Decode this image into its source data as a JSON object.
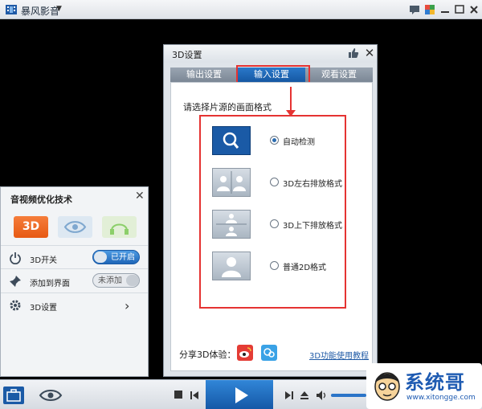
{
  "app": {
    "title": "暴风影音"
  },
  "dialog": {
    "title": "3D设置",
    "tabs": [
      {
        "label": "输出设置"
      },
      {
        "label": "输入设置"
      },
      {
        "label": "观看设置"
      }
    ],
    "prompt": "请选择片源的画面格式",
    "formats": [
      {
        "label": "自动检测",
        "selected": true,
        "icon": "search-icon"
      },
      {
        "label": "3D左右排放格式",
        "selected": false,
        "icon": "side-by-side-icon"
      },
      {
        "label": "3D上下排放格式",
        "selected": false,
        "icon": "top-bottom-icon"
      },
      {
        "label": "普通2D格式",
        "selected": false,
        "icon": "single-person-icon"
      }
    ],
    "share_label": "分享3D体验：",
    "tutorial_link": "3D功能使用教程"
  },
  "left_panel": {
    "title": "音视频优化技术",
    "feature_3d_label": "3D",
    "rows": [
      {
        "label": "3D开关",
        "toggle": "已开启",
        "icon": "power-icon"
      },
      {
        "label": "添加到界面",
        "toggle": "未添加",
        "icon": "pin-icon"
      },
      {
        "label": "3D设置",
        "icon": "gear-icon"
      }
    ]
  },
  "watermark": {
    "name": "系统哥",
    "url": "www.xitongge.com"
  },
  "colors": {
    "accent": "#1a5aa6",
    "highlight": "#e53332",
    "orange": "#e75a14"
  }
}
